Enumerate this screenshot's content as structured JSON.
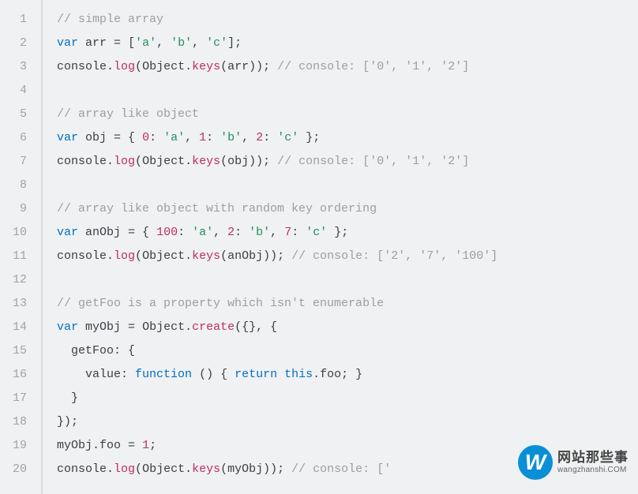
{
  "lineNumbers": [
    "1",
    "2",
    "3",
    "4",
    "5",
    "6",
    "7",
    "8",
    "9",
    "10",
    "11",
    "12",
    "13",
    "14",
    "15",
    "16",
    "17",
    "18",
    "19",
    "20"
  ],
  "code": {
    "l1": {
      "comment": "// simple array"
    },
    "l2": {
      "kw": "var",
      "id": "arr",
      "eq": " = ",
      "op": "[",
      "s1": "'a'",
      "c1": ", ",
      "s2": "'b'",
      "c2": ", ",
      "s3": "'c'",
      "cl": "];"
    },
    "l3": {
      "obj": "console",
      "dot1": ".",
      "m1": "log",
      "p1": "(",
      "obj2": "Object",
      "dot2": ".",
      "m2": "keys",
      "p2": "(",
      "arg": "arr",
      "p3": "));",
      "sp": " ",
      "comment": "// console: ['0', '1', '2']"
    },
    "l4": {},
    "l5": {
      "comment": "// array like object"
    },
    "l6": {
      "kw": "var",
      "id": "obj",
      "eq": " = { ",
      "k1": "0",
      "c1": ": ",
      "v1": "'a'",
      "s1": ", ",
      "k2": "1",
      "c2": ": ",
      "v2": "'b'",
      "s2": ", ",
      "k3": "2",
      "c3": ": ",
      "v3": "'c'",
      "end": " };"
    },
    "l7": {
      "obj": "console",
      "dot1": ".",
      "m1": "log",
      "p1": "(",
      "obj2": "Object",
      "dot2": ".",
      "m2": "keys",
      "p2": "(",
      "arg": "obj",
      "p3": "));",
      "sp": " ",
      "comment": "// console: ['0', '1', '2']"
    },
    "l8": {},
    "l9": {
      "comment": "// array like object with random key ordering"
    },
    "l10": {
      "kw": "var",
      "id": "anObj",
      "eq": " = { ",
      "k1": "100",
      "c1": ": ",
      "v1": "'a'",
      "s1": ", ",
      "k2": "2",
      "c2": ": ",
      "v2": "'b'",
      "s2": ", ",
      "k3": "7",
      "c3": ": ",
      "v3": "'c'",
      "end": " };"
    },
    "l11": {
      "obj": "console",
      "dot1": ".",
      "m1": "log",
      "p1": "(",
      "obj2": "Object",
      "dot2": ".",
      "m2": "keys",
      "p2": "(",
      "arg": "anObj",
      "p3": "));",
      "sp": " ",
      "comment": "// console: ['2', '7', '100']"
    },
    "l12": {},
    "l13": {
      "comment": "// getFoo is a property which isn't enumerable"
    },
    "l14": {
      "kw": "var",
      "id": "myObj",
      "eq": " = ",
      "obj2": "Object",
      "dot2": ".",
      "m2": "create",
      "p1": "({}, {"
    },
    "l15": {
      "indent": "  ",
      "prop": "getFoo",
      "colon": ": {"
    },
    "l16": {
      "indent": "    ",
      "prop": "value",
      "colon": ": ",
      "kw": "function",
      "args": " () { ",
      "ret": "return",
      "sp": " ",
      "this": "this",
      "dot": ".",
      "foo": "foo",
      "end": "; }"
    },
    "l17": {
      "indent": "  ",
      "end": "}"
    },
    "l18": {
      "end": "});"
    },
    "l19": {
      "id": "myObj",
      "dot": ".",
      "prop": "foo",
      "eq": " = ",
      "num": "1",
      "end": ";"
    },
    "l20": {
      "obj": "console",
      "dot1": ".",
      "m1": "log",
      "p1": "(",
      "obj2": "Object",
      "dot2": ".",
      "m2": "keys",
      "p2": "(",
      "arg": "myObj",
      "p3": "));",
      "sp": " ",
      "comment": "// console: ['"
    }
  },
  "watermark": {
    "badge": "W",
    "title": "网站那些事",
    "url": "wangzhanshi.COM"
  }
}
